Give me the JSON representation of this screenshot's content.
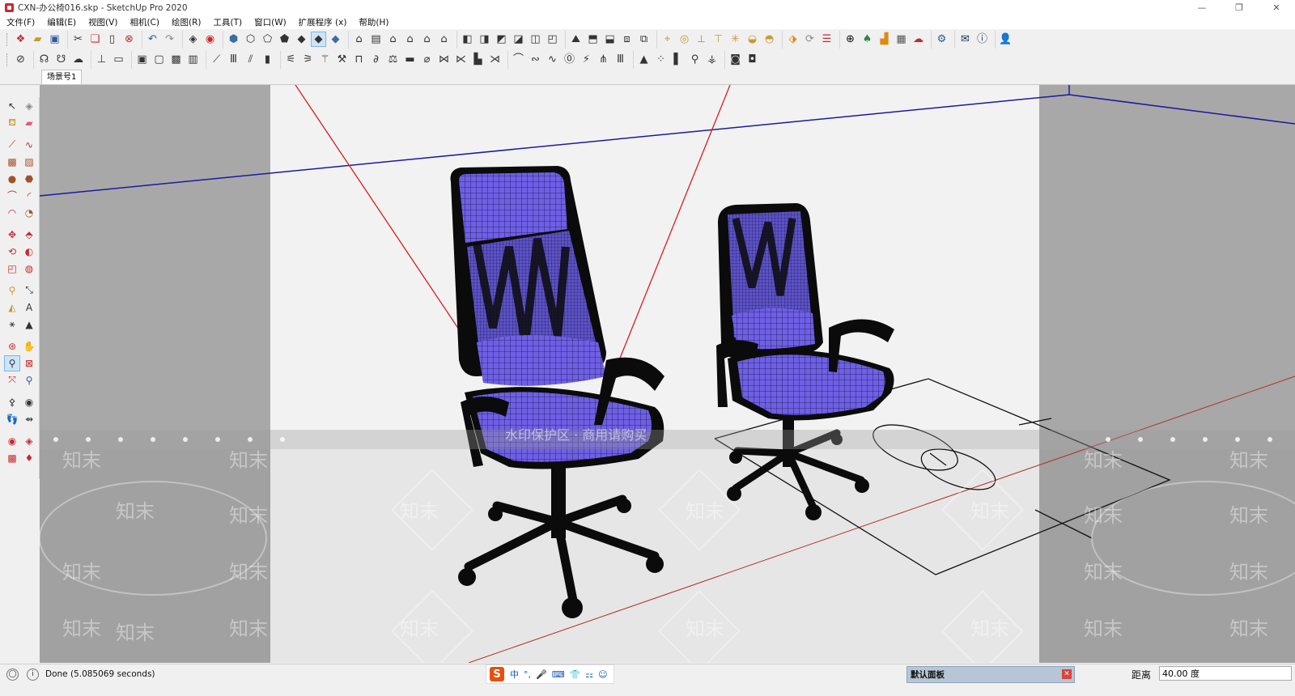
{
  "window": {
    "title": "CXN-办公椅016.skp - SketchUp Pro 2020",
    "controls": {
      "minimize": "—",
      "maximize": "❐",
      "close": "✕"
    }
  },
  "menu": [
    "文件(F)",
    "编辑(E)",
    "视图(V)",
    "相机(C)",
    "绘图(R)",
    "工具(T)",
    "窗口(W)",
    "扩展程序 (x)",
    "帮助(H)"
  ],
  "scene_tab": "场景号1",
  "viewport": {
    "watermark_text": "知末",
    "watermark_banner": "水印保护区 · 商用请购买"
  },
  "status": {
    "message": "Done (5.085069 seconds)",
    "panel_label": "默认面板",
    "measure_label": "距离",
    "measure_value": "40.00 度"
  },
  "ime": {
    "logo": "S",
    "lang": "中",
    "items": [
      "°,",
      "🎤",
      "⌨",
      "👕",
      "⚏",
      "☺"
    ]
  },
  "colors": {
    "chair_fill": "#6f5fe6",
    "mesh_line": "#1a1a40",
    "frame": "#0b0b0b",
    "axis_red": "#d42020",
    "axis_blue": "#1a1aa0",
    "accent": "#cce4f7"
  }
}
